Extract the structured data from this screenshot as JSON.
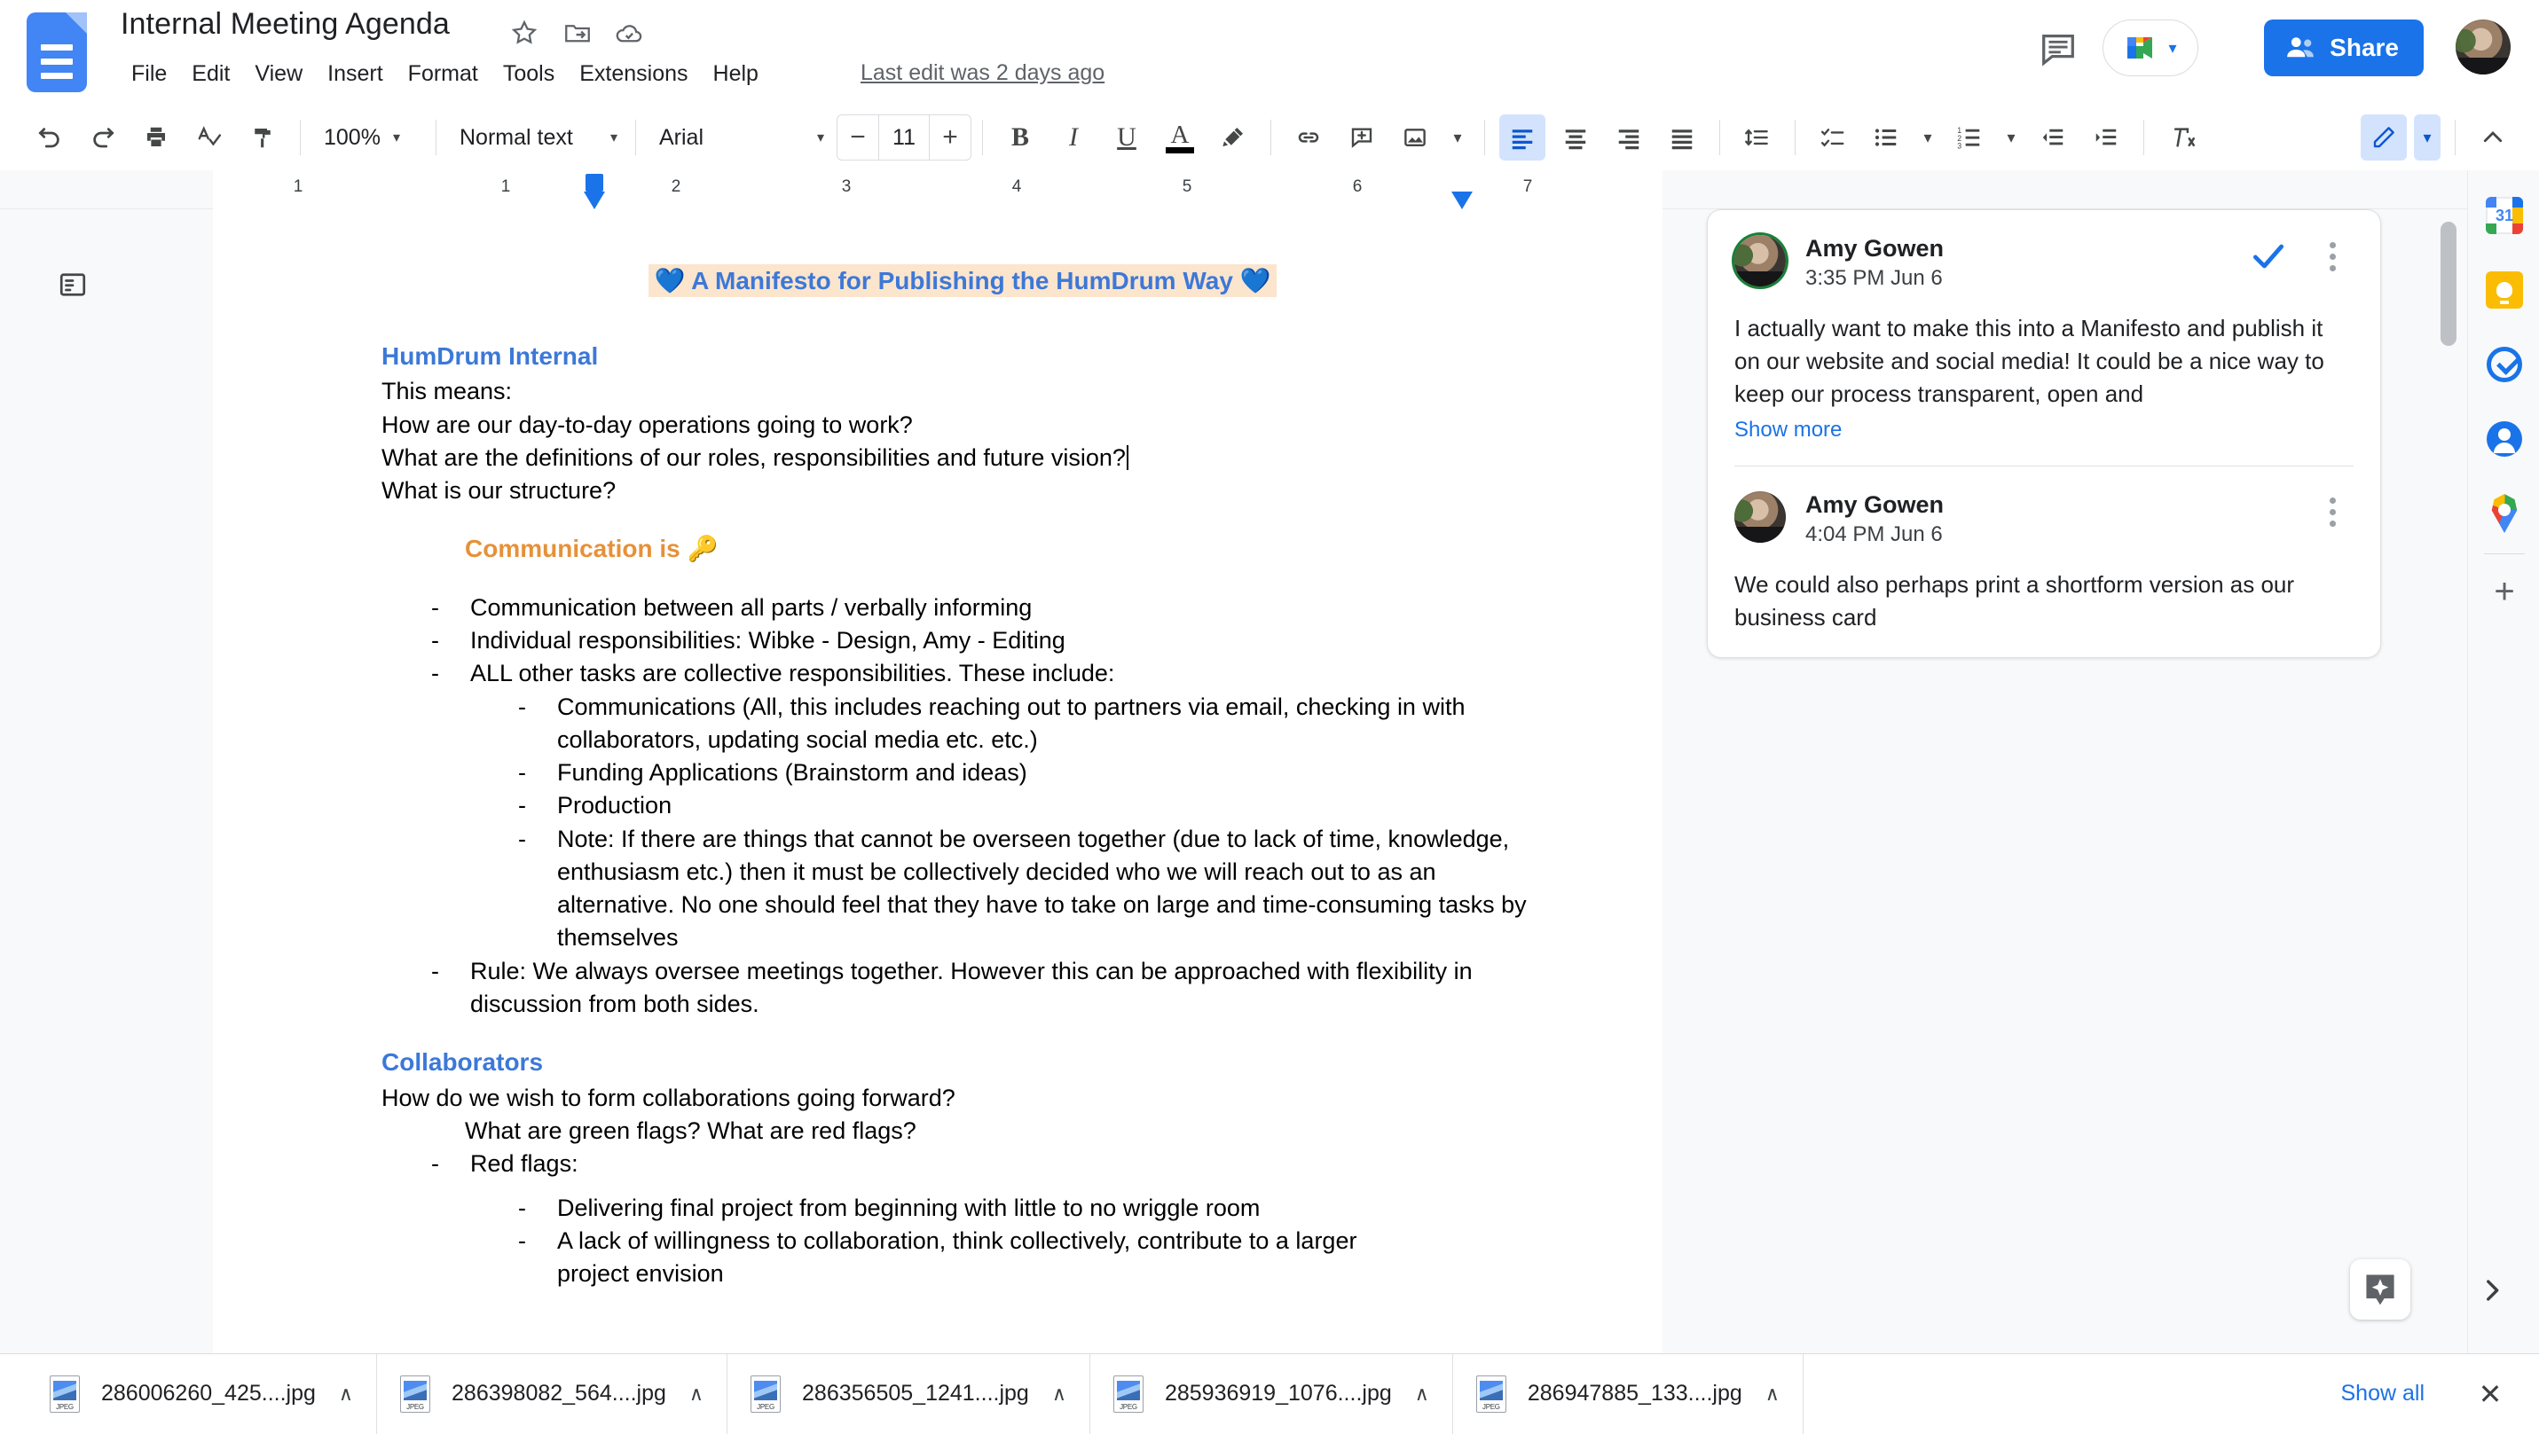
{
  "app": {
    "doc_title": "Internal Meeting Agenda",
    "last_edit": "Last edit was 2 days ago",
    "share_label": "Share"
  },
  "menu": {
    "items": [
      "File",
      "Edit",
      "View",
      "Insert",
      "Format",
      "Tools",
      "Extensions",
      "Help"
    ]
  },
  "toolbar": {
    "zoom": "100%",
    "style": "Normal text",
    "font": "Arial",
    "font_size": "11",
    "minus": "−",
    "plus": "+",
    "bold": "B",
    "italic": "I",
    "underline": "U",
    "text_color": "A",
    "caret": "▾"
  },
  "ruler": {
    "numbers": [
      "1",
      "1",
      "2",
      "3",
      "4",
      "5",
      "6",
      "7"
    ],
    "left_indent_in": 0.5,
    "right_indent_in": 6.5
  },
  "document": {
    "title_emoji_left": "💙",
    "title_emoji_right": "💙",
    "title_text": "A Manifesto for Publishing the HumDrum Way",
    "title_highlight_color": "#fce5cd",
    "title_text_color": "#3c78d8",
    "heading1": "HumDrum Internal",
    "lines_after_heading1": [
      "This means:",
      "How are our day-to-day operations going to work?",
      "What are the definitions of our roles, responsibilities and future vision?",
      "What is our structure?"
    ],
    "heading2": "Communication is 🔑",
    "heading2_color": "#e69138",
    "bullets": [
      {
        "text": "Communication between all parts / verbally informing",
        "children": []
      },
      {
        "text": "Individual responsibilities: Wibke - Design, Amy - Editing",
        "children": []
      },
      {
        "text": "ALL other tasks are collective responsibilities. These include:",
        "children": [
          "Communications (All, this includes reaching out to partners via email, checking in with collaborators, updating social media etc. etc.)",
          "Funding Applications (Brainstorm and ideas)",
          "Production",
          "Note: If there are things that cannot be overseen together (due to lack of time, knowledge, enthusiasm etc.) then it must be collectively decided who we will reach out to as an alternative. No one should feel that they have to take on large and time-consuming tasks by themselves"
        ]
      },
      {
        "text": "Rule: We always oversee meetings together. However this can be approached with flexibility in discussion from both sides.",
        "children": []
      }
    ],
    "heading3": "Collaborators",
    "collab_line1": "How do we wish to form collaborations going forward?",
    "collab_line2": "What are green flags? What are red flags?",
    "collab_bullet1": "Red flags:",
    "collab_sub1": "Delivering final project from beginning with little to no wriggle room",
    "collab_sub2": "A lack of willingness to collaboration, think collectively, contribute to a larger",
    "collab_sub2_cut": "project envision"
  },
  "comments": [
    {
      "author": "Amy Gowen",
      "timestamp": "3:35 PM Jun 6",
      "body": "I actually want to make this into a Manifesto and publish it on our website and social media! It could be a nice way to keep our process transparent, open and",
      "show_more": "Show more",
      "has_resolve": true
    },
    {
      "author": "Amy Gowen",
      "timestamp": "4:04 PM Jun 6",
      "body": "We could also perhaps print a shortform version as our business card",
      "show_more": "",
      "has_resolve": false
    }
  ],
  "side_rail": {
    "items": [
      "calendar-icon",
      "keep-icon",
      "tasks-icon",
      "contacts-icon",
      "maps-icon"
    ],
    "calendar_day": "31",
    "add_label": "+"
  },
  "downloads": {
    "files": [
      "286006260_425....jpg",
      "286398082_564....jpg",
      "286356505_1241....jpg",
      "285936919_1076....jpg",
      "286947885_133....jpg"
    ],
    "caret": "∧",
    "show_all": "Show all",
    "close": "✕",
    "file_type_label": "JPEG"
  },
  "colors": {
    "accent": "#1a73e8",
    "heading_blue": "#3c78d8",
    "heading_orange": "#e69138",
    "highlight": "#fce5cd"
  }
}
